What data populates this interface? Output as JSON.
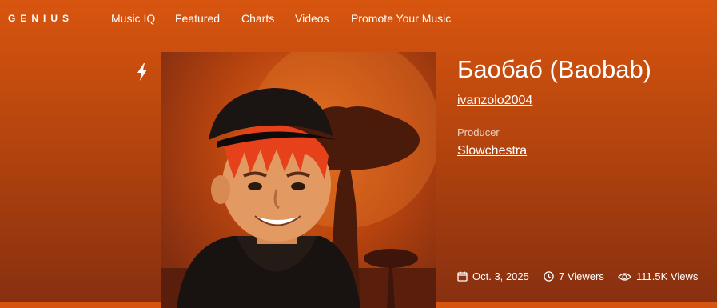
{
  "nav": {
    "logo": "GENIUS",
    "items": [
      {
        "label": "Music IQ"
      },
      {
        "label": "Featured"
      },
      {
        "label": "Charts"
      },
      {
        "label": "Videos"
      },
      {
        "label": "Promote Your Music"
      }
    ]
  },
  "song": {
    "title": "Баобаб (Baobab)",
    "artist": "ivanzolo2004",
    "credits": [
      {
        "label": "Producer",
        "value": "Slowchestra"
      }
    ],
    "meta": {
      "date": "Oct. 3, 2025",
      "viewers": "7 Viewers",
      "views": "111.5K Views"
    }
  },
  "icons": {
    "hot": "lightning-bolt-icon",
    "date": "calendar-icon",
    "viewers": "clock-icon",
    "views": "eye-icon"
  },
  "colors": {
    "background_top": "#d8550f",
    "background_bottom": "#883010",
    "text": "#ffffff"
  }
}
